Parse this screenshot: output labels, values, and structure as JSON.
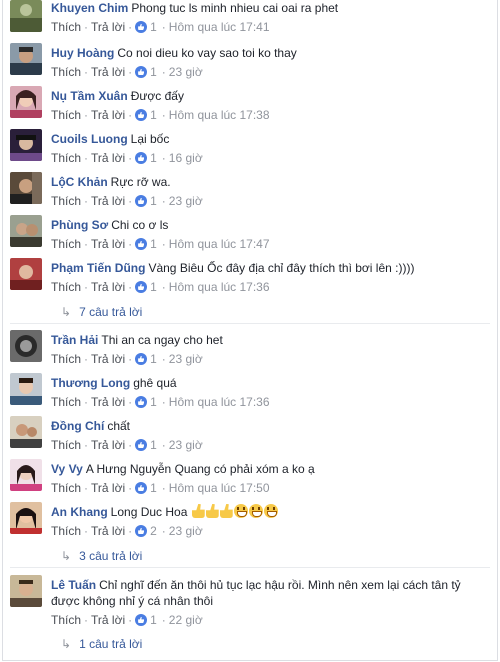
{
  "labels": {
    "like": "Thích",
    "reply": "Trả lời"
  },
  "comments": [
    {
      "name": "Khuyen Chim",
      "text": "Phong tuc ls minh nhieu cai oai ra phet",
      "likes": "1",
      "time": "Hôm qua lúc 17:41"
    },
    {
      "name": "Huy Hoàng",
      "text": "Co noi dieu ko vay sao toi ko thay",
      "likes": "1",
      "time": "23 giờ"
    },
    {
      "name": "Nụ Tầm Xuân",
      "text": "Được đấy",
      "likes": "1",
      "time": "Hôm qua lúc 17:38"
    },
    {
      "name": "Cuoils Luong",
      "text": "Lại bốc",
      "likes": "1",
      "time": "16 giờ"
    },
    {
      "name": "LộC Khản",
      "text": "Rực rỡ wa.",
      "likes": "1",
      "time": "23 giờ"
    },
    {
      "name": "Phùng Sơ",
      "text": "Chi co ơ ls",
      "likes": "1",
      "time": "Hôm qua lúc 17:47"
    },
    {
      "name": "Phạm Tiến Dũng",
      "text": "Vàng Biêu Ốc đây địa chỉ đây thích thì bơi lên :))))",
      "likes": "1",
      "time": "Hôm qua lúc 17:36",
      "replies": "7 câu trả lời"
    },
    {
      "name": "Trần Hải",
      "text": "Thi an ca ngay cho het",
      "likes": "1",
      "time": "23 giờ"
    },
    {
      "name": "Thương Long",
      "text": "ghê quá",
      "likes": "1",
      "time": "Hôm qua lúc 17:36"
    },
    {
      "name": "Đồng Chí",
      "text": "chất",
      "likes": "1",
      "time": "23 giờ"
    },
    {
      "name": "Vy Vy",
      "text": "A Hưng Nguyễn Quang có phải xóm a ko ạ",
      "likes": "1",
      "time": "Hôm qua lúc 17:50"
    },
    {
      "name": "An Khang",
      "text": "Long Duc Hoa",
      "emoji": [
        "thumbs-up",
        "thumbs-up",
        "thumbs-up",
        "grin",
        "grin",
        "grin"
      ],
      "likes": "2",
      "time": "23 giờ",
      "replies": "3 câu trả lời"
    },
    {
      "name": "Lê Tuấn",
      "text": "Chỉ nghĩ đến ăn thôi hủ tục lạc hậu rồi. Mình nên xem lại cách tân tỷ được không nhỉ ý cá nhân thôi",
      "likes": "1",
      "time": "22 giờ",
      "replies": "1 câu trả lời"
    }
  ],
  "colors": {
    "name": "#365899",
    "meta": "#90949c",
    "like_badge": "#4a7de2"
  }
}
